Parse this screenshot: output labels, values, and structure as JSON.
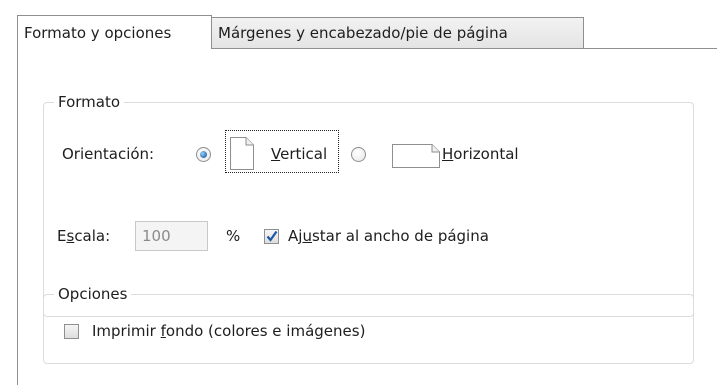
{
  "tabs": [
    {
      "label": "Formato y opciones"
    },
    {
      "label": "Márgenes y encabezado/pie de página"
    }
  ],
  "format_group": {
    "legend": "Formato",
    "orientation_label": "Orientación:",
    "vertical": {
      "pre": "",
      "accel": "V",
      "post": "ertical",
      "selected": true
    },
    "horizontal": {
      "pre": "",
      "accel": "H",
      "post": "orizontal",
      "selected": false
    },
    "scale_label": {
      "pre": "E",
      "accel": "s",
      "post": "cala:"
    },
    "scale_value": "100",
    "percent": "%",
    "fit_width": {
      "pre": "Aj",
      "accel": "u",
      "post": "star al ancho de página",
      "checked": true
    }
  },
  "options_group": {
    "legend": "Opciones",
    "print_bg": {
      "pre": "Imprimir ",
      "accel": "f",
      "post": "ondo (colores e imágenes)",
      "checked": false
    }
  },
  "colors": {
    "border": "#8e8f8f",
    "group_border": "#dcdcdc",
    "radio_dot": "#2a71b5",
    "check_mark": "#1a56a6"
  },
  "icons": {
    "vertical_page": "portrait-page-icon",
    "horizontal_page": "landscape-page-icon"
  }
}
